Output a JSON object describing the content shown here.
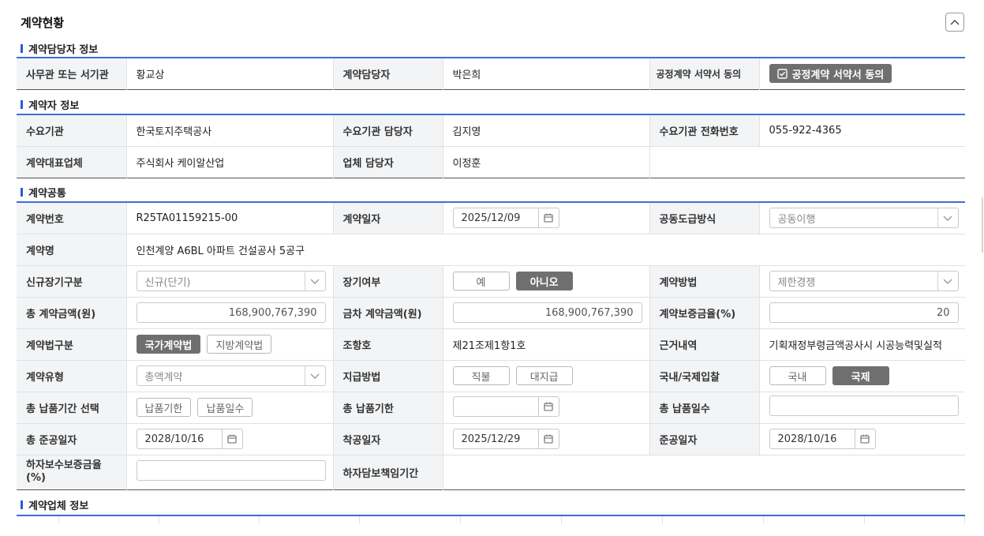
{
  "page_title": "계약현황",
  "sections": {
    "manager": "계약담당자 정보",
    "contractor": "계약자 정보",
    "common": "계약공통",
    "company": "계약업체 정보"
  },
  "manager_info": {
    "l1": "사무관 또는 서기관",
    "v1": "황교상",
    "l2": "계약담당자",
    "v2": "박은희",
    "l3": "공정계약 서약서 동의",
    "v3": "공정계약 서약서 동의"
  },
  "contractor_info": {
    "r1": {
      "l1": "수요기관",
      "v1": "한국토지주택공사",
      "l2": "수요기관 담당자",
      "v2": "김지영",
      "l3": "수요기관 전화번호",
      "v3": "055-922-4365"
    },
    "r2": {
      "l1": "계약대표업체",
      "v1": "주식회사 케이알산업",
      "l2": "업체 담당자",
      "v2": "이정훈"
    }
  },
  "common": {
    "contract_no_label": "계약번호",
    "contract_no": "R25TA01159215-00",
    "contract_date_label": "계약일자",
    "contract_date": "2025/12/09",
    "joint_method_label": "공동도급방식",
    "joint_method": "공동이행",
    "contract_name_label": "계약명",
    "contract_name": "인천계양 A6BL 아파트 건설공사 5공구",
    "new_long_label": "신규장기구분",
    "new_long": "신규(단기)",
    "long_term_label": "장기여부",
    "long_yes": "예",
    "long_no": "아니오",
    "method_label": "계약방법",
    "method": "제한경쟁",
    "total_amount_label": "총 계약금액(원)",
    "total_amount": "168,900,767,390",
    "this_amount_label": "금차 계약금액(원)",
    "this_amount": "168,900,767,390",
    "guarantee_rate_label": "계약보증금율(%)",
    "guarantee_rate": "20",
    "law_label": "계약법구분",
    "law_national": "국가계약법",
    "law_local": "지방계약법",
    "clause_label": "조항호",
    "clause": "제21조제1항1호",
    "basis_label": "근거내역",
    "basis": "기획재정부령금액공사시 시공능력및실적",
    "type_label": "계약유형",
    "type": "총액계약",
    "payment_label": "지급방법",
    "pay_direct": "직불",
    "pay_proxy": "대지급",
    "bid_label": "국내/국제입찰",
    "bid_domestic": "국내",
    "bid_intl": "국제",
    "delivery_sel_label": "총 납품기간 선택",
    "delivery_deadline_btn": "납품기한",
    "delivery_days_btn": "납품일수",
    "delivery_deadline_label": "총 납품기한",
    "delivery_days_label": "총 납품일수",
    "completion_total_label": "총 준공일자",
    "completion_total": "2028/10/16",
    "start_label": "착공일자",
    "start": "2025/12/29",
    "completion_label": "준공일자",
    "completion": "2028/10/16",
    "defect_rate_label": "하자보수보증금율(%)",
    "defect_period_label": "하자담보책임기간"
  }
}
